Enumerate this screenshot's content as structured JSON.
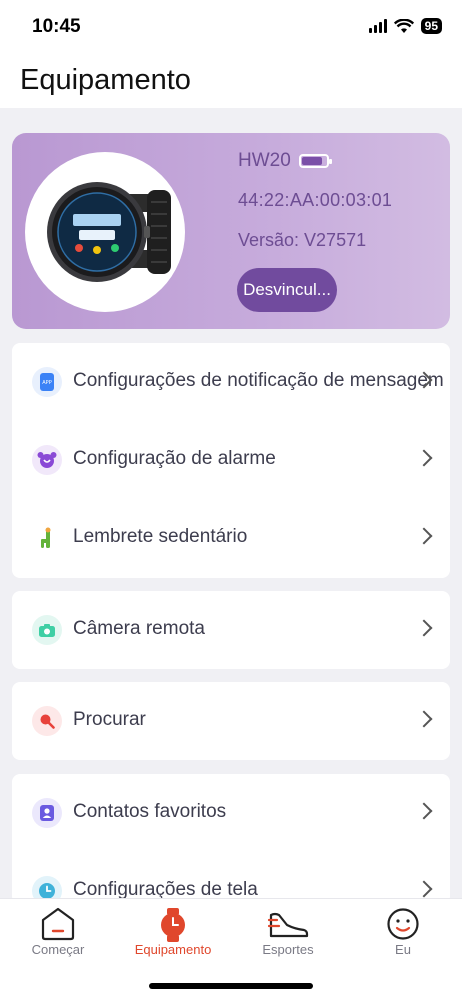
{
  "status_bar": {
    "time": "10:45",
    "battery": "95"
  },
  "header": {
    "title": "Equipamento"
  },
  "device": {
    "name": "HW20",
    "mac": "44:22:AA:00:03:01",
    "version": "Versão: V27571",
    "unbind_label": "Desvincul..."
  },
  "menu": {
    "notifications": "Configurações de notificação de mensagem",
    "alarm": "Configuração de alarme",
    "sedentary": "Lembrete sedentário",
    "camera": "Câmera remota",
    "search": "Procurar",
    "contacts": "Contatos favoritos",
    "screen": "Configurações de tela"
  },
  "tabs": {
    "start": "Começar",
    "equipment": "Equipamento",
    "sports": "Esportes",
    "me": "Eu"
  },
  "colors": {
    "accent": "#e0472c",
    "card_purple": "#c7acdc",
    "button_purple": "#714b9e"
  }
}
